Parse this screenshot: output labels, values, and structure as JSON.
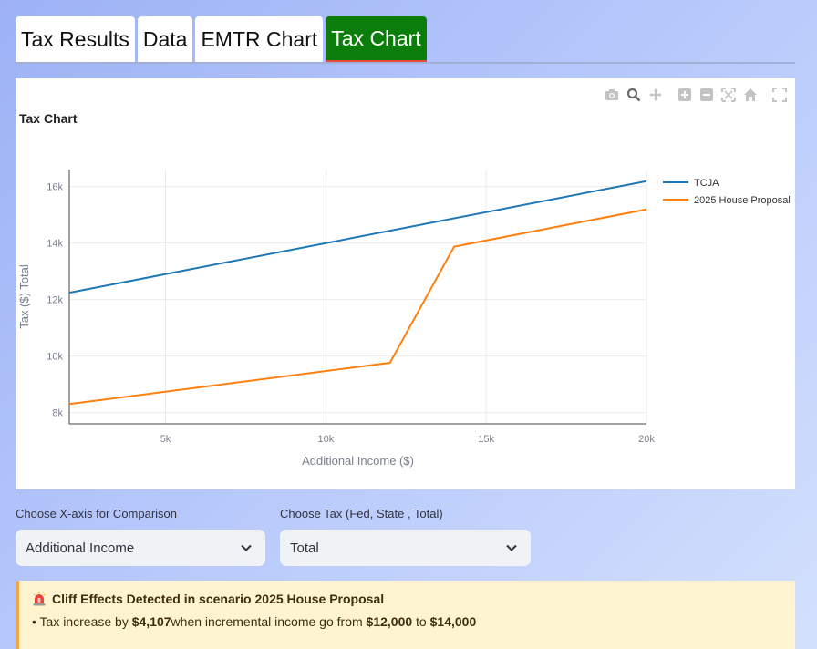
{
  "tabs": [
    {
      "label": "Tax Results",
      "active": false
    },
    {
      "label": "Data",
      "active": false
    },
    {
      "label": "EMTR Chart",
      "active": false
    },
    {
      "label": "Tax Chart",
      "active": true
    }
  ],
  "modebar": [
    "camera-icon",
    "zoom-icon",
    "pan-icon",
    "zoom-in-icon",
    "zoom-out-icon",
    "autoscale-icon",
    "reset-axes-icon",
    "fullscreen-icon"
  ],
  "chart_data": {
    "type": "line",
    "title": "Tax Chart",
    "xlabel": "Additional Income ($)",
    "ylabel": "Tax ($) Total",
    "xlim": [
      2000,
      20000
    ],
    "ylim": [
      7600,
      16600
    ],
    "xticks": [
      5000,
      10000,
      15000,
      20000
    ],
    "xtick_labels": [
      "5k",
      "10k",
      "15k",
      "20k"
    ],
    "yticks": [
      8000,
      10000,
      12000,
      14000,
      16000
    ],
    "ytick_labels": [
      "8k",
      "10k",
      "12k",
      "14k",
      "16k"
    ],
    "grid": true,
    "legend_position": "top-right",
    "series": [
      {
        "name": "TCJA",
        "color": "#1f77b4",
        "x": [
          2000,
          20000
        ],
        "y": [
          12240,
          16190
        ]
      },
      {
        "name": "2025 House Proposal",
        "color": "#ff7f0e",
        "x": [
          2000,
          12000,
          14000,
          20000
        ],
        "y": [
          8300,
          9760,
          13870,
          15190
        ]
      }
    ]
  },
  "controls": {
    "xaxis_label": "Choose X-axis for Comparison",
    "xaxis_value": "Additional Income",
    "tax_label": "Choose Tax (Fed, State , Total)",
    "tax_value": "Total"
  },
  "warning": {
    "icon": "siren-icon",
    "title": "Cliff Effects Detected in scenario 2025 House Proposal",
    "bullet": "•",
    "text1": "Tax increase by ",
    "amount": "$4,107",
    "text2": "when incremental income go from ",
    "from": "$12,000",
    "text3": " to ",
    "to": "$14,000"
  }
}
